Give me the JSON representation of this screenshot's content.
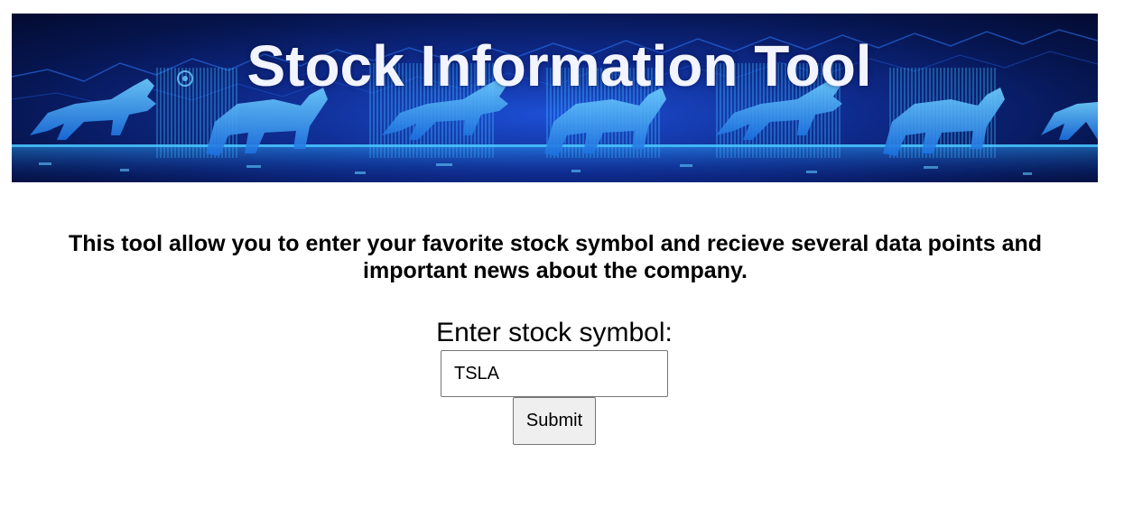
{
  "banner": {
    "title": "Stock Information Tool",
    "colors": {
      "background_dark": "#06154f",
      "background_mid": "#0e2a8c",
      "glow": "#1d9bf0",
      "figure": "#3ab4ff",
      "title_text": "#f2f4ff"
    },
    "decor": "bull-and-bear-silhouettes"
  },
  "description": {
    "text": "This tool allow you to enter your favorite stock symbol and recieve several data points and important news about the company."
  },
  "form": {
    "label": "Enter stock symbol:",
    "input_value": "TSLA",
    "submit_label": "Submit"
  }
}
